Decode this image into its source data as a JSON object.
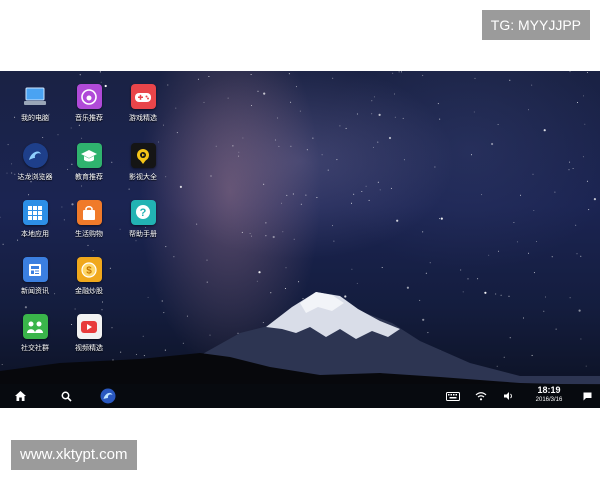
{
  "watermarks": {
    "top": "TG: MYYJJPP",
    "bottom": "www.xktypt.com"
  },
  "desktop": {
    "icons": [
      {
        "label": "我的电脑",
        "icon": "computer-icon",
        "color": "#3a8ee6",
        "glyph": ""
      },
      {
        "label": "音乐推荐",
        "icon": "music-icon",
        "color": "#b04ad8",
        "glyph": "♪"
      },
      {
        "label": "游戏精选",
        "icon": "gamepad-icon",
        "color": "#e8454a",
        "glyph": ""
      },
      {
        "label": "达龙浏览器",
        "icon": "browser-icon",
        "color": "#2a5fbf",
        "glyph": ""
      },
      {
        "label": "教育推荐",
        "icon": "graduation-cap-icon",
        "color": "#2fb36e",
        "glyph": "🎓"
      },
      {
        "label": "影视大全",
        "icon": "video-play-icon",
        "color": "#151515",
        "glyph": ""
      },
      {
        "label": "本地应用",
        "icon": "app-grid-icon",
        "color": "#2d8fe6",
        "glyph": ""
      },
      {
        "label": "生活购物",
        "icon": "shopping-bag-icon",
        "color": "#f07a2a",
        "glyph": ""
      },
      {
        "label": "帮助手册",
        "icon": "help-icon",
        "color": "#22b3b3",
        "glyph": "?"
      },
      {
        "label": "新闻资讯",
        "icon": "news-icon",
        "color": "#3b7fe0",
        "glyph": ""
      },
      {
        "label": "金融炒股",
        "icon": "finance-coin-icon",
        "color": "#f0a81c",
        "glyph": "$"
      },
      {
        "label": "社交社群",
        "icon": "social-group-icon",
        "color": "#3ab54a",
        "glyph": ""
      },
      {
        "label": "视频精选",
        "icon": "video-icon",
        "color": "#f2f2f2",
        "glyph": ""
      }
    ]
  },
  "taskbar": {
    "clock_time": "18:19",
    "clock_date": "2016/3/16"
  }
}
